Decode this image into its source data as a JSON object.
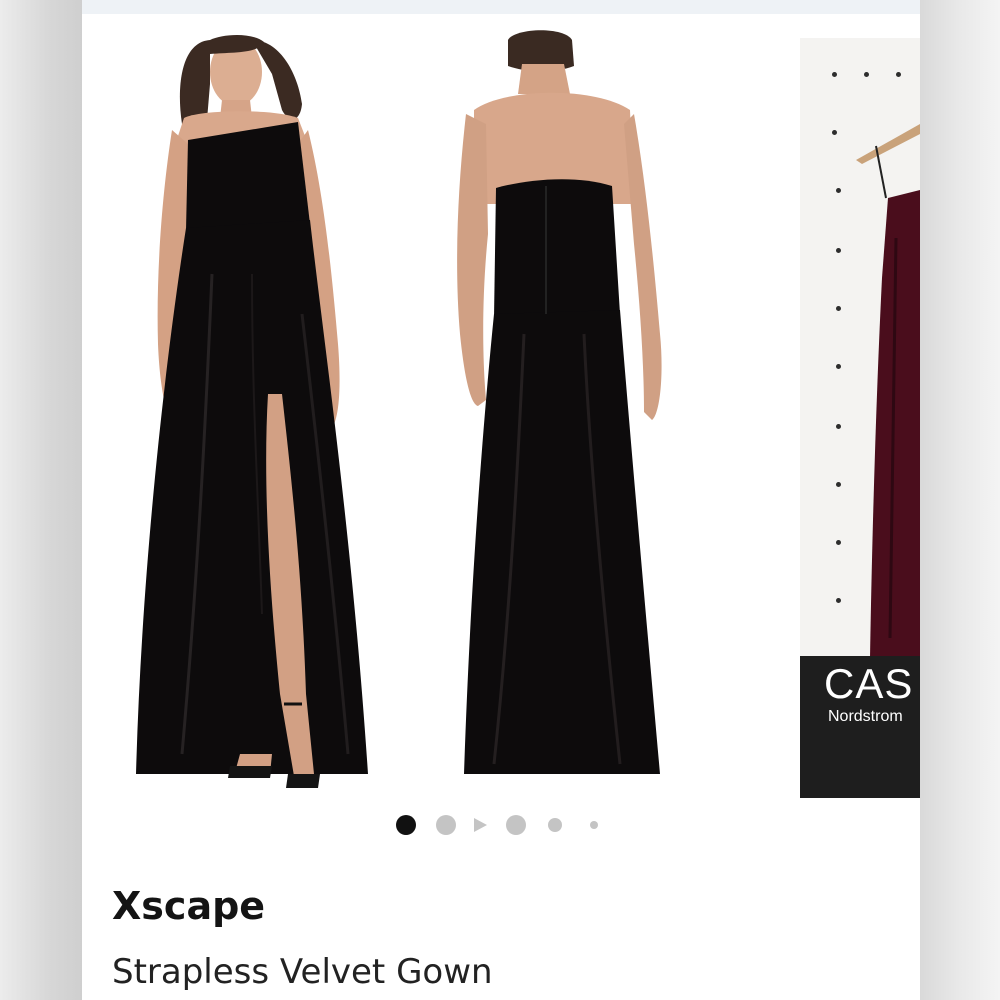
{
  "product": {
    "brand": "Xscape",
    "title": "Strapless Velvet Gown"
  },
  "carousel": {
    "slides": [
      {
        "label": "front view",
        "icon": "gown-front"
      },
      {
        "label": "back view",
        "icon": "gown-back"
      },
      {
        "label": "hanger view",
        "icon": "gown-hanger"
      }
    ],
    "slide3_text": {
      "brand": "CAS",
      "sub": "Nordstrom"
    },
    "page_count": 6,
    "active_index": 0
  },
  "colors": {
    "gown": "#0d0b0c",
    "burgundy": "#4a0d1c",
    "skin": "#d9a88c",
    "active_dot": "#111111",
    "inactive_dot": "#c4c4c4"
  }
}
